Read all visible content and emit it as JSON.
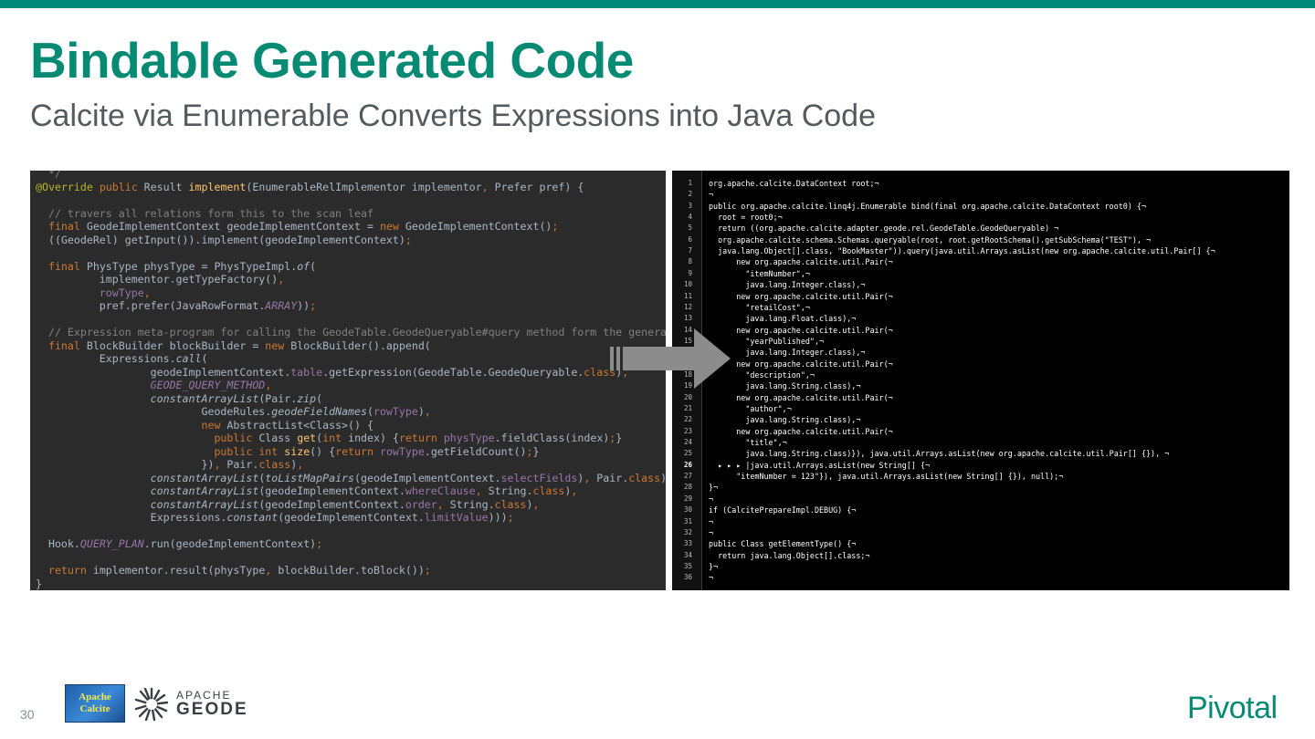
{
  "slide": {
    "title": "Bindable Generated Code",
    "subtitle": "Calcite via Enumerable Converts Expressions into Java Code",
    "page_number": "30",
    "brand": "Pivotal",
    "accent_color": "#00897b"
  },
  "logos": {
    "calcite_line1": "Apache",
    "calcite_line2": "Calcite",
    "geode_line1": "APACHE",
    "geode_line2": "GEODE"
  },
  "left_code": {
    "language": "java",
    "lines": [
      "  */",
      "@Override public Result implement(EnumerableRelImplementor implementor, Prefer pref) {",
      "",
      "  // travers all relations form this to the scan leaf",
      "  final GeodeImplementContext geodeImplementContext = new GeodeImplementContext();",
      "  ((GeodeRel) getInput()).implement(geodeImplementContext);",
      "",
      "  final PhysType physType = PhysTypeImpl.of(",
      "          implementor.getTypeFactory(),",
      "          rowType,",
      "          pref.prefer(JavaRowFormat.ARRAY));",
      "",
      "  // Expression meta-program for calling the GeodeTable.GeodeQueryable#query method form the generated code",
      "  final BlockBuilder blockBuilder = new BlockBuilder().append(",
      "          Expressions.call(",
      "                  geodeImplementContext.table.getExpression(GeodeTable.GeodeQueryable.class),",
      "                  GEODE_QUERY_METHOD,",
      "                  constantArrayList(Pair.zip(",
      "                          GeodeRules.geodeFieldNames(rowType),",
      "                          new AbstractList<Class>() {",
      "                            public Class get(int index) {return physType.fieldClass(index);}",
      "                            public int size() {return rowType.getFieldCount();}",
      "                          }), Pair.class),",
      "                  constantArrayList(toListMapPairs(geodeImplementContext.selectFields), Pair.class),",
      "                  constantArrayList(geodeImplementContext.whereClause, String.class),",
      "                  constantArrayList(geodeImplementContext.order, String.class),",
      "                  Expressions.constant(geodeImplementContext.limitValue)));",
      "",
      "  Hook.QUERY_PLAN.run(geodeImplementContext);",
      "",
      "  return implementor.result(physType, blockBuilder.toBlock());",
      "}"
    ]
  },
  "right_code": {
    "current_line": "26",
    "lines": [
      {
        "n": "1",
        "t": "org.apache.calcite.DataContext root;¬"
      },
      {
        "n": "2",
        "t": "¬"
      },
      {
        "n": "3",
        "t": "public org.apache.calcite.linq4j.Enumerable bind(final org.apache.calcite.DataContext root0) {¬"
      },
      {
        "n": "4",
        "t": "  root = root0;¬"
      },
      {
        "n": "5",
        "t": "  return ((org.apache.calcite.adapter.geode.rel.GeodeTable.GeodeQueryable) ¬"
      },
      {
        "n": "6",
        "t": "  org.apache.calcite.schema.Schemas.queryable(root, root.getRootSchema().getSubSchema(\"TEST\"), ¬"
      },
      {
        "n": "7",
        "t": "  java.lang.Object[].class, \"BookMaster\")).query(java.util.Arrays.asList(new org.apache.calcite.util.Pair[] {¬"
      },
      {
        "n": "8",
        "t": "      new org.apache.calcite.util.Pair(¬"
      },
      {
        "n": "9",
        "t": "        \"itemNumber\",¬"
      },
      {
        "n": "10",
        "t": "        java.lang.Integer.class),¬"
      },
      {
        "n": "11",
        "t": "      new org.apache.calcite.util.Pair(¬"
      },
      {
        "n": "12",
        "t": "        \"retailCost\",¬"
      },
      {
        "n": "13",
        "t": "        java.lang.Float.class),¬"
      },
      {
        "n": "14",
        "t": "      new org.apache.calcite.util.Pair(¬"
      },
      {
        "n": "15",
        "t": "        \"yearPublished\",¬"
      },
      {
        "n": "16",
        "t": "        java.lang.Integer.class),¬"
      },
      {
        "n": "17",
        "t": "      new org.apache.calcite.util.Pair(¬"
      },
      {
        "n": "18",
        "t": "        \"description\",¬"
      },
      {
        "n": "19",
        "t": "        java.lang.String.class),¬"
      },
      {
        "n": "20",
        "t": "      new org.apache.calcite.util.Pair(¬"
      },
      {
        "n": "21",
        "t": "        \"author\",¬"
      },
      {
        "n": "22",
        "t": "        java.lang.String.class),¬"
      },
      {
        "n": "23",
        "t": "      new org.apache.calcite.util.Pair(¬"
      },
      {
        "n": "24",
        "t": "        \"title\",¬"
      },
      {
        "n": "25",
        "t": "        java.lang.String.class)}), java.util.Arrays.asList(new org.apache.calcite.util.Pair[] {}), ¬"
      },
      {
        "n": "26",
        "t": "  ▸ ▸ ▸ |java.util.Arrays.asList(new String[] {¬"
      },
      {
        "n": "27",
        "t": "      \"itemNumber = 123\"}), java.util.Arrays.asList(new String[] {}), null);¬"
      },
      {
        "n": "28",
        "t": "}¬"
      },
      {
        "n": "29",
        "t": "¬"
      },
      {
        "n": "30",
        "t": "if (CalcitePrepareImpl.DEBUG) {¬"
      },
      {
        "n": "31",
        "t": "¬"
      },
      {
        "n": "32",
        "t": "¬"
      },
      {
        "n": "33",
        "t": "public Class getElementType() {¬"
      },
      {
        "n": "34",
        "t": "  return java.lang.Object[].class;¬"
      },
      {
        "n": "35",
        "t": "}¬"
      },
      {
        "n": "36",
        "t": "¬"
      }
    ]
  }
}
